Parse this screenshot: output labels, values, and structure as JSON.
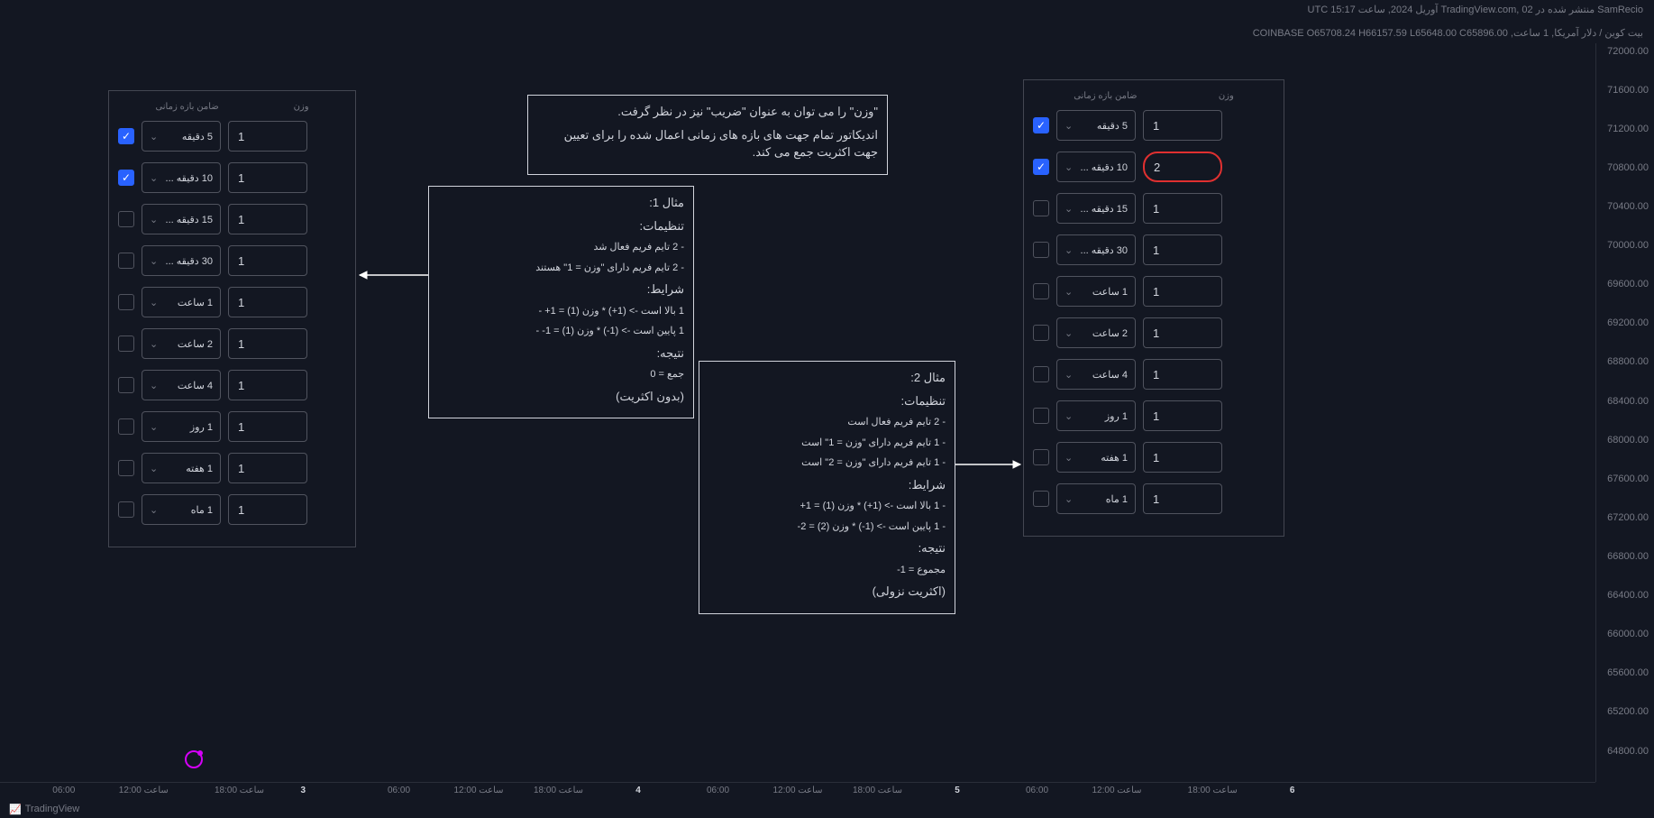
{
  "header": {
    "publish_line": "SamRecio منتشر شده در TradingView.com, 02 آوریل 2024, ساعت 15:17 UTC",
    "symbol_line": "بیت کوین / دلار آمریکا, 1 ساعت, COINBASE O65708.24 H66157.59 L65648.00 C65896.00"
  },
  "y_ticks": [
    "72000.00",
    "71600.00",
    "71200.00",
    "70800.00",
    "70400.00",
    "70000.00",
    "69600.00",
    "69200.00",
    "68800.00",
    "68400.00",
    "68000.00",
    "67600.00",
    "67200.00",
    "66800.00",
    "66400.00",
    "66000.00",
    "65600.00",
    "65200.00",
    "64800.00"
  ],
  "x_ticks": [
    {
      "label": "06:00",
      "pos": 4
    },
    {
      "label": "12:00 ساعت",
      "pos": 9
    },
    {
      "label": "18:00 ساعت",
      "pos": 15
    },
    {
      "label": "3",
      "pos": 19,
      "bold": true
    },
    {
      "label": "06:00",
      "pos": 25
    },
    {
      "label": "12:00 ساعت",
      "pos": 30
    },
    {
      "label": "18:00 ساعت",
      "pos": 35
    },
    {
      "label": "4",
      "pos": 40,
      "bold": true
    },
    {
      "label": "06:00",
      "pos": 45
    },
    {
      "label": "12:00 ساعت",
      "pos": 50
    },
    {
      "label": "18:00 ساعت",
      "pos": 55
    },
    {
      "label": "5",
      "pos": 60,
      "bold": true
    },
    {
      "label": "06:00",
      "pos": 65
    },
    {
      "label": "12:00 ساعت",
      "pos": 70
    },
    {
      "label": "18:00 ساعت",
      "pos": 76
    },
    {
      "label": "6",
      "pos": 81,
      "bold": true
    }
  ],
  "panel_headers": {
    "tf": "ضامن بازه زمانی",
    "wt": "وزن"
  },
  "timeframes": [
    "5 دقیقه",
    "10 دقیقه ...",
    "15 دقیقه ...",
    "30 دقیقه ...",
    "1 ساعت",
    "2 ساعت",
    "4 ساعت",
    "1 روز",
    "1 هفته",
    "1 ماه"
  ],
  "left_panel": {
    "rows": [
      {
        "on": true,
        "val": "1"
      },
      {
        "on": true,
        "val": "1"
      },
      {
        "on": false,
        "val": "1"
      },
      {
        "on": false,
        "val": "1"
      },
      {
        "on": false,
        "val": "1"
      },
      {
        "on": false,
        "val": "1"
      },
      {
        "on": false,
        "val": "1"
      },
      {
        "on": false,
        "val": "1"
      },
      {
        "on": false,
        "val": "1"
      },
      {
        "on": false,
        "val": "1"
      }
    ]
  },
  "right_panel": {
    "rows": [
      {
        "on": true,
        "val": "1"
      },
      {
        "on": true,
        "val": "2",
        "hl": true
      },
      {
        "on": false,
        "val": "1"
      },
      {
        "on": false,
        "val": "1"
      },
      {
        "on": false,
        "val": "1"
      },
      {
        "on": false,
        "val": "1"
      },
      {
        "on": false,
        "val": "1"
      },
      {
        "on": false,
        "val": "1"
      },
      {
        "on": false,
        "val": "1"
      },
      {
        "on": false,
        "val": "1"
      }
    ]
  },
  "note_top": {
    "l1": "\"وزن\" را می توان به عنوان \"ضریب\" نیز در نظر گرفت.",
    "l2": "اندیکاتور تمام جهت های بازه های زمانی اعمال شده را برای تعیین جهت اکثریت جمع می کند."
  },
  "note_ex1": {
    "title": "مثال 1:",
    "settings": "تنظیمات:",
    "s1": "- 2 تایم فریم فعال شد",
    "s2": "- 2 تایم فریم دارای \"وزن = 1\" هستند",
    "cond": "شرایط:",
    "c1": "1 بالا است -> (1+) * وزن (1) = 1+ -",
    "c2": "1 پایین است -> (1-) * وزن (1) = 1- -",
    "res": "نتیجه:",
    "r1": "جمع = 0",
    "r2": "(بدون اکثریت)"
  },
  "note_ex2": {
    "title": "مثال 2:",
    "settings": "تنظیمات:",
    "s1": "- 2 تایم فریم فعال است",
    "s2": "- 1 تایم فریم دارای \"وزن = 1\" است",
    "s3": "- 1 تایم فریم دارای \"وزن = 2\" است",
    "cond": "شرایط:",
    "c1": "- 1 بالا است -> (1+) * وزن (1) = 1+",
    "c2": "- 1 پایین است -> (1-) * وزن (2) = 2-",
    "res": "نتیجه:",
    "r1": "مجموع = 1-",
    "r2": "(اکثریت نزولی)"
  },
  "footer": "TradingView"
}
